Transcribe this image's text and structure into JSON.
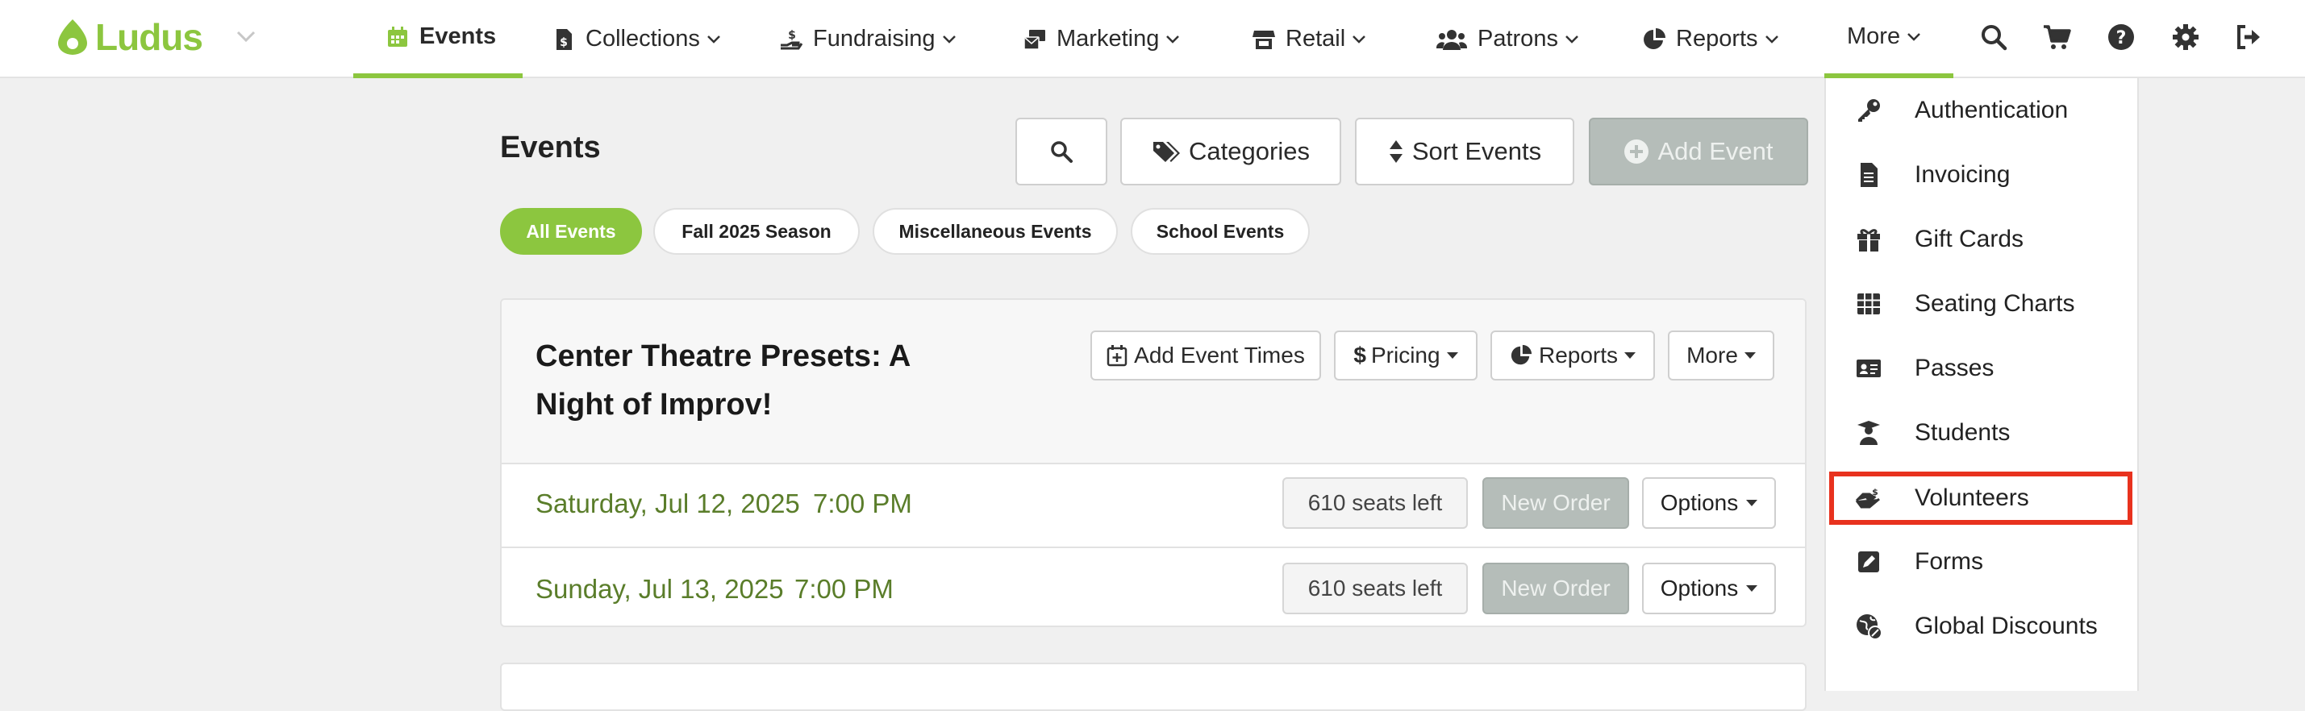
{
  "brand": {
    "name": "Ludus",
    "accent": "#8cc63f"
  },
  "nav": {
    "events": "Events",
    "collections": "Collections",
    "fundraising": "Fundraising",
    "marketing": "Marketing",
    "retail": "Retail",
    "patrons": "Patrons",
    "reports": "Reports",
    "more": "More"
  },
  "toolbar_icons": [
    "search-icon",
    "cart-icon",
    "help-icon",
    "gear-icon",
    "logout-icon"
  ],
  "page": {
    "title": "Events",
    "buttons": {
      "categories": "Categories",
      "sort": "Sort Events",
      "add": "Add Event"
    },
    "filters": [
      "All Events",
      "Fall 2025 Season",
      "Miscellaneous Events",
      "School Events"
    ]
  },
  "event": {
    "title": "Center Theatre Presets: A Night of Improv!",
    "actions": {
      "add_times": "Add Event Times",
      "pricing": "Pricing",
      "reports": "Reports",
      "more": "More"
    },
    "performances": [
      {
        "date": "Saturday, Jul 12, 2025",
        "time": "7:00 PM",
        "seats": "610 seats left",
        "new_order": "New Order",
        "options": "Options"
      },
      {
        "date": "Sunday, Jul 13, 2025",
        "time": "7:00 PM",
        "seats": "610 seats left",
        "new_order": "New Order",
        "options": "Options"
      }
    ]
  },
  "more_menu": {
    "items": [
      {
        "label": "Authentication",
        "icon": "key-icon"
      },
      {
        "label": "Invoicing",
        "icon": "invoice-icon"
      },
      {
        "label": "Gift Cards",
        "icon": "gift-icon"
      },
      {
        "label": "Seating Charts",
        "icon": "grid-icon"
      },
      {
        "label": "Passes",
        "icon": "id-card-icon"
      },
      {
        "label": "Students",
        "icon": "graduate-icon"
      },
      {
        "label": "Volunteers",
        "icon": "hands-icon"
      },
      {
        "label": "Forms",
        "icon": "form-icon"
      },
      {
        "label": "Global Discounts",
        "icon": "globe-discount-icon"
      }
    ],
    "highlighted": "Volunteers",
    "highlight_color": "#e8321e"
  }
}
